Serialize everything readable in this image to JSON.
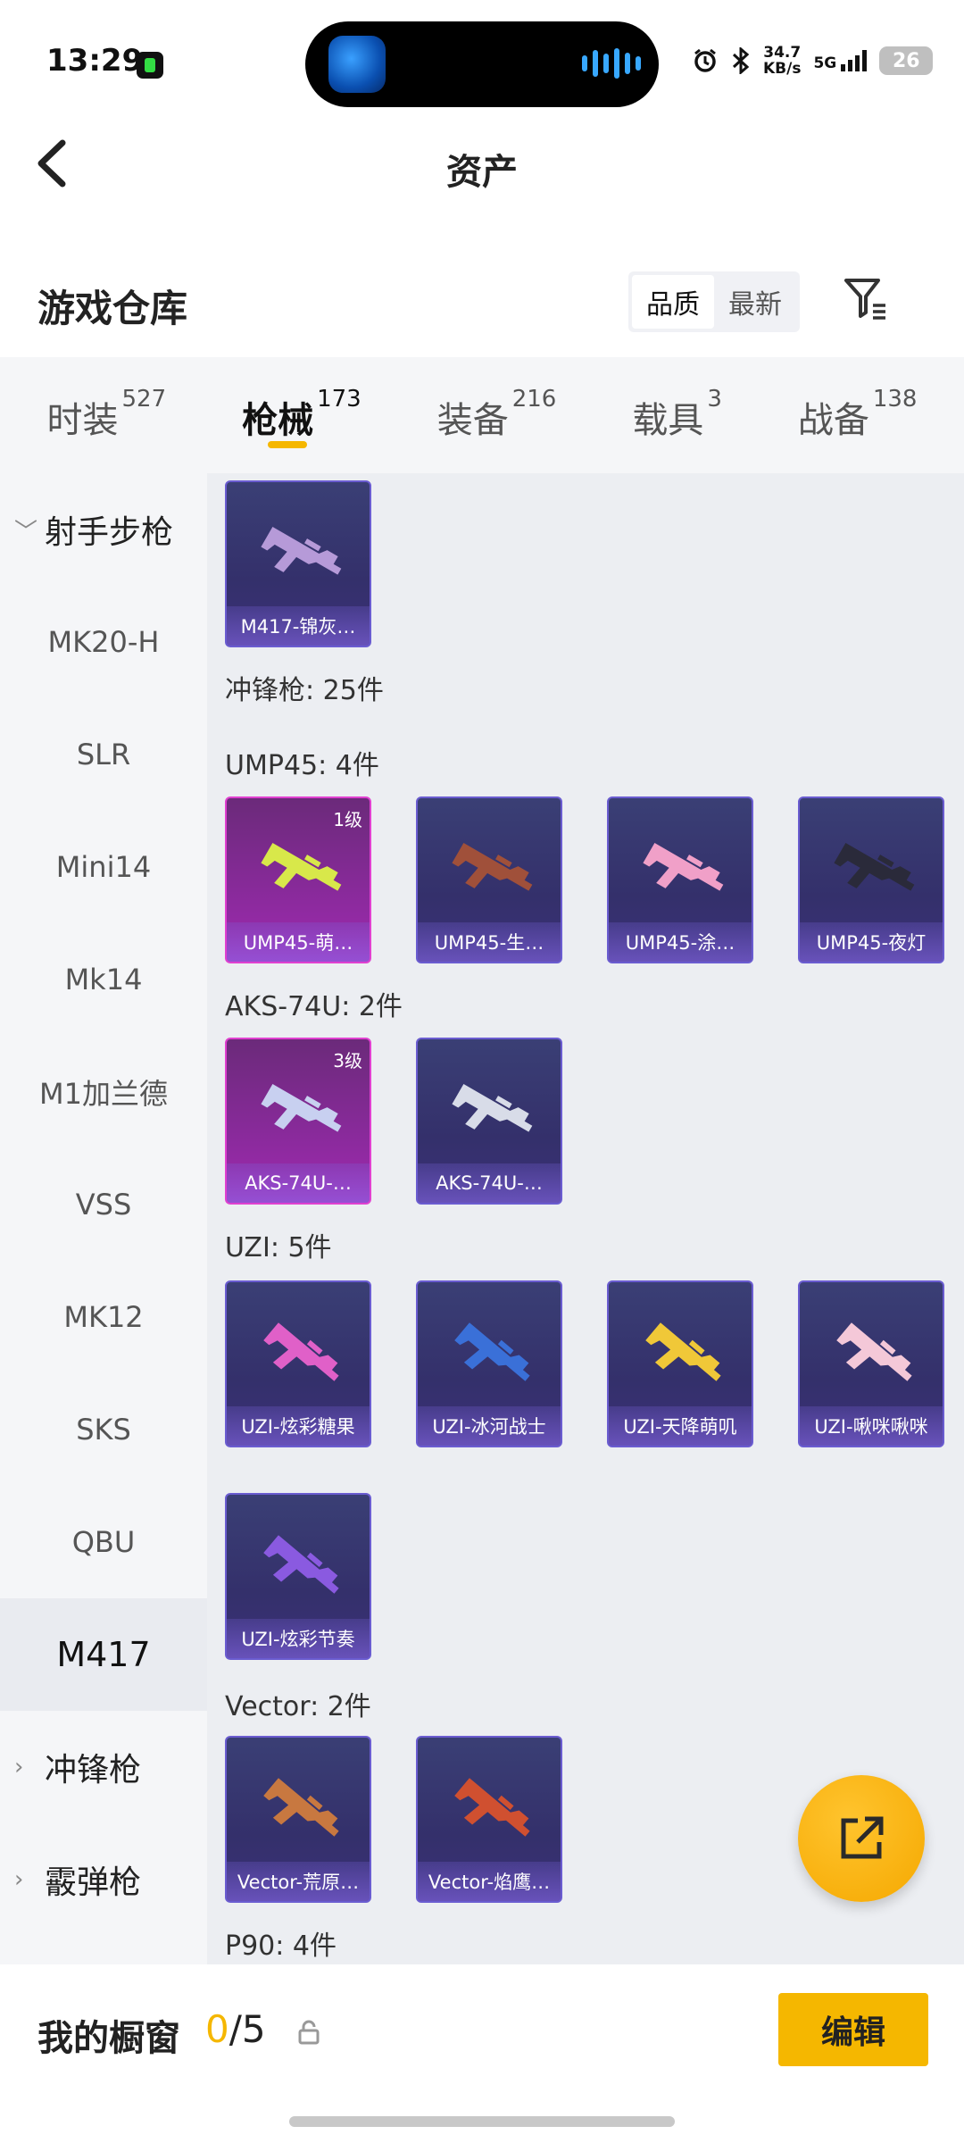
{
  "status": {
    "time": "13:29",
    "speed": "34.7",
    "speed_unit": "KB/s",
    "network": "5G",
    "battery": "26"
  },
  "header": {
    "title": "资产"
  },
  "warehouse": {
    "title": "游戏仓库",
    "sort_options": [
      "品质",
      "最新"
    ],
    "selected_sort": "品质"
  },
  "tabs": [
    {
      "label": "时装",
      "count": "527"
    },
    {
      "label": "枪械",
      "count": "173",
      "active": true
    },
    {
      "label": "装备",
      "count": "216"
    },
    {
      "label": "载具",
      "count": "3"
    },
    {
      "label": "战备",
      "count": "138"
    }
  ],
  "sidebar": {
    "group_marksman": "射手步枪",
    "items": [
      "MK20-H",
      "SLR",
      "Mini14",
      "Mk14",
      "M1加兰德",
      "VSS",
      "MK12",
      "SKS",
      "QBU",
      "M417"
    ],
    "selected": "M417",
    "group_smg": "冲锋枪",
    "group_shotgun": "霰弹枪"
  },
  "content": {
    "m417_items": [
      {
        "name": "M417-锦灰…"
      }
    ],
    "smg_total": "冲锋枪: 25件",
    "sections": [
      {
        "title": "UMP45: 4件",
        "items": [
          {
            "name": "UMP45-萌…",
            "level": "1级",
            "highlight": true
          },
          {
            "name": "UMP45-生…"
          },
          {
            "name": "UMP45-涂…"
          },
          {
            "name": "UMP45-夜灯"
          }
        ]
      },
      {
        "title": "AKS-74U: 2件",
        "items": [
          {
            "name": "AKS-74U-…",
            "level": "3级",
            "highlight": true
          },
          {
            "name": "AKS-74U-…"
          }
        ]
      },
      {
        "title": "UZI: 5件",
        "items": [
          {
            "name": "UZI-炫彩糖果"
          },
          {
            "name": "UZI-冰河战士"
          },
          {
            "name": "UZI-天降萌叽"
          },
          {
            "name": "UZI-啾咪啾咪"
          },
          {
            "name": "UZI-炫彩节奏"
          }
        ]
      },
      {
        "title": "Vector: 2件",
        "items": [
          {
            "name": "Vector-荒原…"
          },
          {
            "name": "Vector-焰鹰…"
          }
        ]
      },
      {
        "title": "P90: 4件",
        "items": []
      }
    ]
  },
  "footer": {
    "showcase_label": "我的橱窗",
    "showcase_current": "0",
    "showcase_max": "/5",
    "edit_label": "编辑"
  },
  "colors": {
    "accent": "#f5b700",
    "card_bg": "#363270",
    "card_highlight": "#a02ab0"
  }
}
